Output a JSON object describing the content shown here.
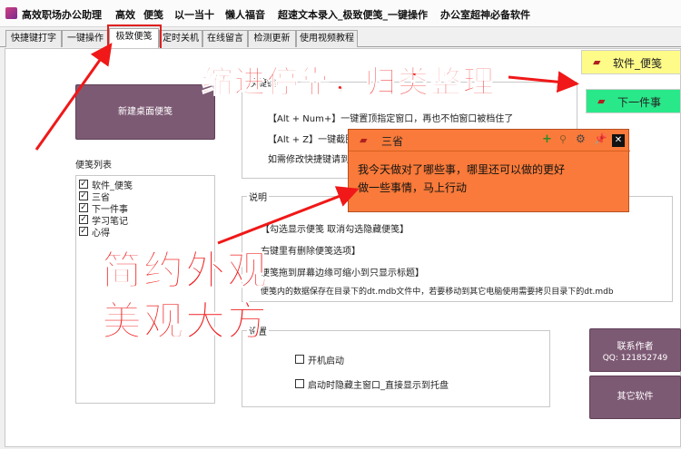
{
  "titlebar": {
    "app_title": "高效职场办公助理",
    "menus": [
      "高效",
      "便笺",
      "以一当十",
      "懒人福音",
      "超速文本录入_极致便笺_一键操作",
      "办公室超神必备软件"
    ]
  },
  "tabs": [
    "快捷键打字",
    "一键操作",
    "极致便笺",
    "定时关机",
    "在线留言",
    "检测更新",
    "使用视频教程"
  ],
  "left": {
    "new_note_button": "新建桌面便笺",
    "list_label": "便笺列表",
    "notes": [
      {
        "label": "软件_便笺",
        "checked": true
      },
      {
        "label": "三省",
        "checked": true
      },
      {
        "label": "下一件事",
        "checked": true
      },
      {
        "label": "学习笔记",
        "checked": true
      },
      {
        "label": "心得",
        "checked": true
      }
    ]
  },
  "shortcuts": {
    "group_label": "快捷键",
    "line1": "【Alt + Num+】一键置顶指定窗口，再也不怕窗口被档住了",
    "line2": "【Alt + Z】一键截图",
    "line3": "如需修改快捷键请到"
  },
  "instructions": {
    "group_label": "说明",
    "line1": "【勾选显示便笺  取消勾选隐藏便笺】",
    "line2": "右键里有删除便笺选项】",
    "line3": "便笺拖到屏幕边缘可缩小到只显示标题】",
    "line4": "便笺内的数据保存在目录下的dt.mdb文件中，若要移动到其它电脑使用需要拷贝目录下的dt.mdb"
  },
  "settings": {
    "group_label": "设置",
    "autostart": {
      "label": "开机启动",
      "checked": false
    },
    "hide_main": {
      "label": "启动时隐藏主窗口_直接显示到托盘",
      "checked": false
    }
  },
  "right_buttons": {
    "contact_label": "联系作者",
    "contact_qq": "QQ: 121852749",
    "other_software": "其它软件"
  },
  "floating_notes": {
    "note1_title": "软件_便笺",
    "note2_title": "下一件事"
  },
  "popup_note": {
    "title": "三省",
    "content": "我今天做对了哪些事，哪里还可以做的更好\n做一些事情，马上行动"
  },
  "annotations": {
    "headline_top": "缩进停靠，归类整理",
    "headline_bottom_line1": "简约外观",
    "headline_bottom_line2": "美观大方"
  },
  "colors": {
    "accent_red": "#f01818",
    "note_yellow": "#fffb88",
    "note_green": "#29e88a",
    "popup_orange": "#f97a3a",
    "button_purple": "#7d5a74"
  }
}
